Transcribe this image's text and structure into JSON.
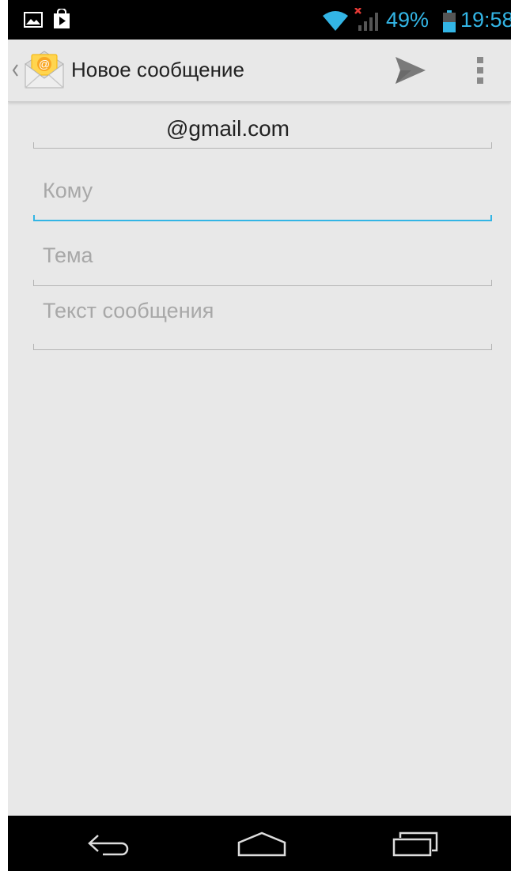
{
  "status_bar": {
    "left_icons": [
      "gallery-icon",
      "shopping-bag-icon"
    ],
    "right_icons": [
      "wifi-icon",
      "signal-no-sim-icon",
      "battery-icon"
    ],
    "battery_percent": "49%",
    "time": "19:58"
  },
  "action_bar": {
    "title": "Новое сообщение",
    "app_icon": "email-icon",
    "send_icon": "send-icon",
    "overflow_icon": "overflow-menu-icon"
  },
  "compose": {
    "from": "@gmail.com",
    "to_placeholder": "Кому",
    "subject_placeholder": "Тема",
    "body_placeholder": "Текст сообщения"
  },
  "nav_bar": {
    "back_icon": "back-icon",
    "home_icon": "home-icon",
    "recents_icon": "recent-apps-icon"
  },
  "colors": {
    "accent": "#33b5e5",
    "background": "#e8e8e8",
    "placeholder": "#a8a8a8"
  }
}
